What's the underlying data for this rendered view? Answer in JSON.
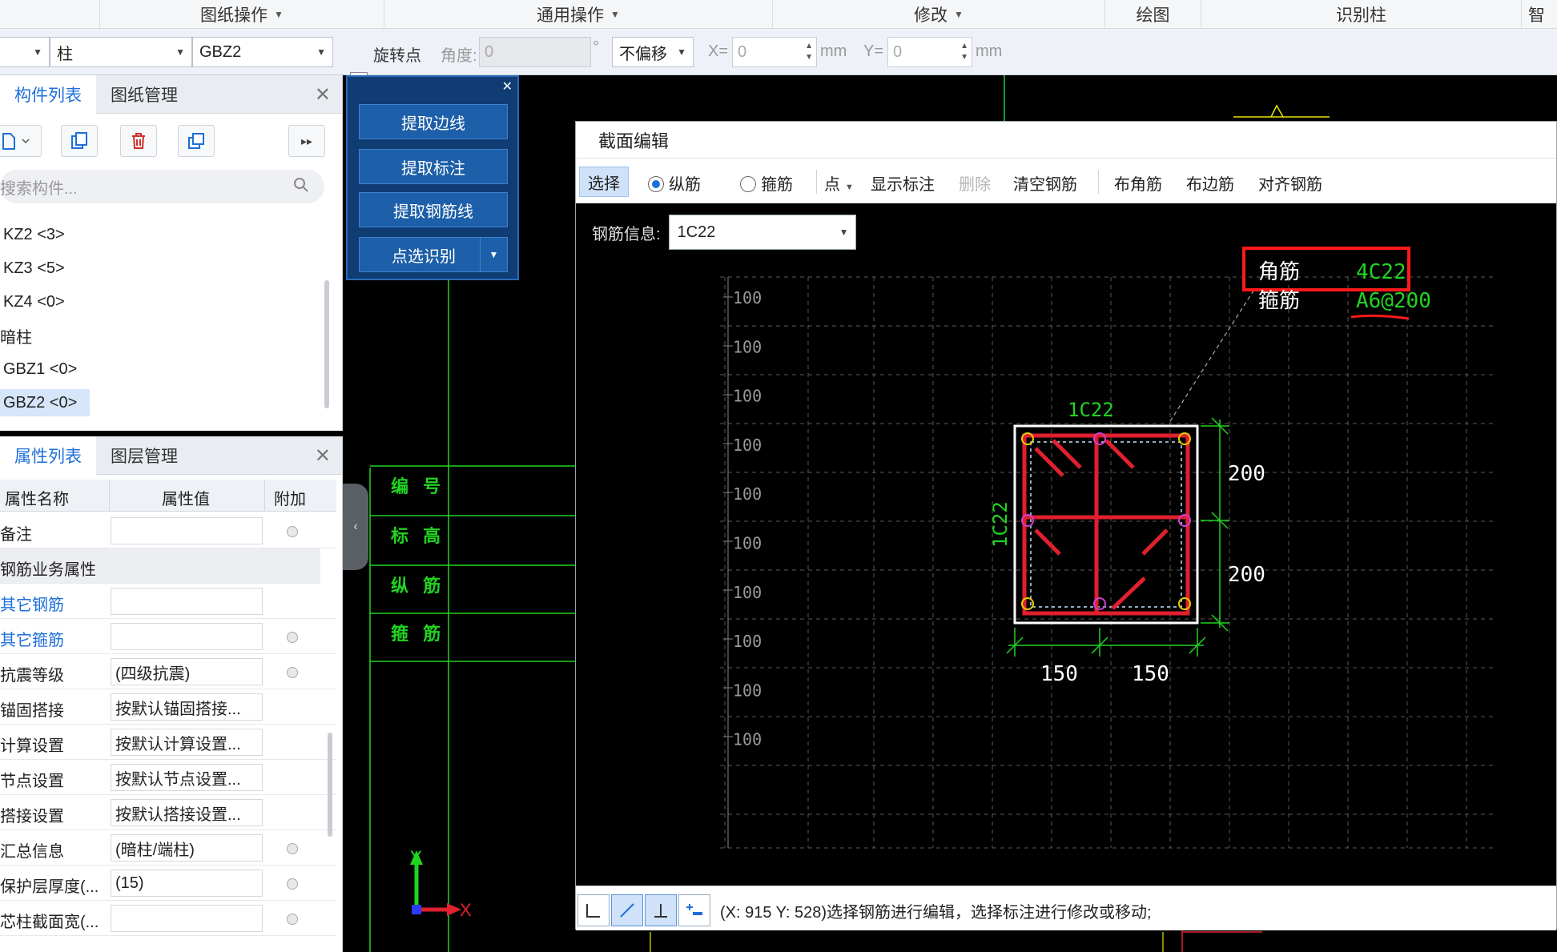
{
  "ribbon": {
    "groups": [
      "图纸操作",
      "通用操作",
      "修改",
      "绘图",
      "识别柱",
      "智"
    ]
  },
  "toolbar": {
    "component_type": "柱",
    "component_name": "GBZ2",
    "rotate_point": "旋转点",
    "angle_label": "角度:",
    "angle_value": "0",
    "angle_unit": "°",
    "offset_mode": "不偏移",
    "x_label": "X=",
    "x_value": "0",
    "x_unit": "mm",
    "y_label": "Y=",
    "y_value": "0",
    "y_unit": "mm"
  },
  "component_panel": {
    "tabs": [
      "构件列表",
      "图纸管理"
    ],
    "search_placeholder": "搜索构件...",
    "items": [
      "KZ2 <3>",
      "KZ3 <5>",
      "KZ4 <0>",
      "暗柱",
      "GBZ1 <0>",
      "GBZ2 <0>"
    ],
    "selected_index": 5
  },
  "property_panel": {
    "tabs": [
      "属性列表",
      "图层管理"
    ],
    "headers": [
      "属性名称",
      "属性值",
      "附加"
    ],
    "rows": [
      {
        "name": "备注",
        "value": "",
        "style": "normal"
      },
      {
        "name": "钢筋业务属性",
        "value": "",
        "style": "group"
      },
      {
        "name": "其它钢筋",
        "value": "",
        "style": "blue"
      },
      {
        "name": "其它箍筋",
        "value": "",
        "style": "blue"
      },
      {
        "name": "抗震等级",
        "value": "(四级抗震)",
        "style": "normal"
      },
      {
        "name": "锚固搭接",
        "value": "按默认锚固搭接...",
        "style": "normal"
      },
      {
        "name": "计算设置",
        "value": "按默认计算设置...",
        "style": "normal"
      },
      {
        "name": "节点设置",
        "value": "按默认节点设置...",
        "style": "normal"
      },
      {
        "name": "搭接设置",
        "value": "按默认搭接设置...",
        "style": "normal"
      },
      {
        "name": "汇总信息",
        "value": "(暗柱/端柱)",
        "style": "normal"
      },
      {
        "name": "保护层厚度(...",
        "value": "(15)",
        "style": "normal"
      },
      {
        "name": "芯柱截面宽(...",
        "value": "",
        "style": "normal"
      }
    ]
  },
  "recognize_panel": {
    "buttons": [
      "提取边线",
      "提取标注",
      "提取钢筋线",
      "点选识别"
    ]
  },
  "drawing_labels": [
    "编 号",
    "标 高",
    "纵 筋",
    "箍 筋"
  ],
  "section_editor": {
    "title": "截面编辑",
    "tools": {
      "select": "选择",
      "longitudinal": "纵筋",
      "stirrup": "箍筋",
      "point": "点",
      "show_annotation": "显示标注",
      "delete": "删除",
      "clear": "清空钢筋",
      "corner": "布角筋",
      "edge": "布边筋",
      "align": "对齐钢筋"
    },
    "rebar_info_label": "钢筋信息:",
    "rebar_info_value": "1C22",
    "grid_labels": [
      "100",
      "100",
      "100",
      "100",
      "100",
      "100",
      "100",
      "100",
      "100",
      "100"
    ],
    "corner_label": "角筋",
    "corner_value": "4C22",
    "stirrup_label": "箍筋",
    "stirrup_value": "A6@200",
    "top_bar": "1C22",
    "side_bar": "1C22",
    "dim_right": [
      "200",
      "200"
    ],
    "dim_bottom": [
      "150",
      "150"
    ],
    "status": "(X: 915 Y: 528)选择钢筋进行编辑，选择标注进行修改或移动;"
  },
  "axis": {
    "y": "Y",
    "x": "X"
  },
  "colors": {
    "cad_green": "#21d421",
    "rebar_red": "#e0202e",
    "highlight_red": "#ff1a1a",
    "accent_blue": "#1e6fd9"
  }
}
